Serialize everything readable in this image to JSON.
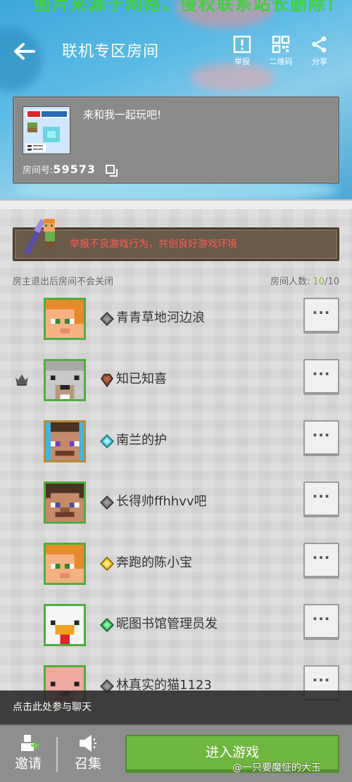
{
  "watermark": "图片来源于网络，侵权联系站长删除！",
  "header": {
    "title": "联机专区房间",
    "actions": [
      {
        "label": "举报",
        "icon": "report-icon"
      },
      {
        "label": "二维码",
        "icon": "qrcode-icon"
      },
      {
        "label": "分享",
        "icon": "share-icon"
      }
    ]
  },
  "room": {
    "description": "来和我一起玩吧!",
    "id_label": "房间号:",
    "id": "59573"
  },
  "banner": {
    "text": "举报不良游戏行为，共创良好游戏环境"
  },
  "info": {
    "note": "房主退出后房间不会关闭",
    "count_label": "房间人数:",
    "count_current": "10",
    "count_max": "/10"
  },
  "players": [
    {
      "name": "青青草地河边浪",
      "gem": "gray",
      "host": false,
      "skin": "alex"
    },
    {
      "name": "知已知喜",
      "gem": "brown",
      "host": true,
      "skin": "wolf"
    },
    {
      "name": "南兰的护",
      "gem": "diamond",
      "host": false,
      "skin": "steve-fancy"
    },
    {
      "name": "长得帅ffhhvv吧",
      "gem": "gray",
      "host": false,
      "skin": "steve"
    },
    {
      "name": "奔跑的陈小宝",
      "gem": "gold",
      "host": false,
      "skin": "alex"
    },
    {
      "name": "昵图书馆管理员发",
      "gem": "emerald",
      "host": false,
      "skin": "chicken"
    },
    {
      "name": "林真实的猫1123",
      "gem": "gray",
      "host": false,
      "skin": "pig"
    }
  ],
  "more_label": "···",
  "chat_prompt": "点击此处参与聊天",
  "bottom": {
    "invite": "邀请",
    "summon": "召集",
    "enter": "进入游戏"
  },
  "credit": "@一只要魔怔的大玉",
  "colors": {
    "accent_green": "#6fb63f",
    "banner_text": "#ff5c50",
    "avatar_border": "#4caf3a"
  }
}
